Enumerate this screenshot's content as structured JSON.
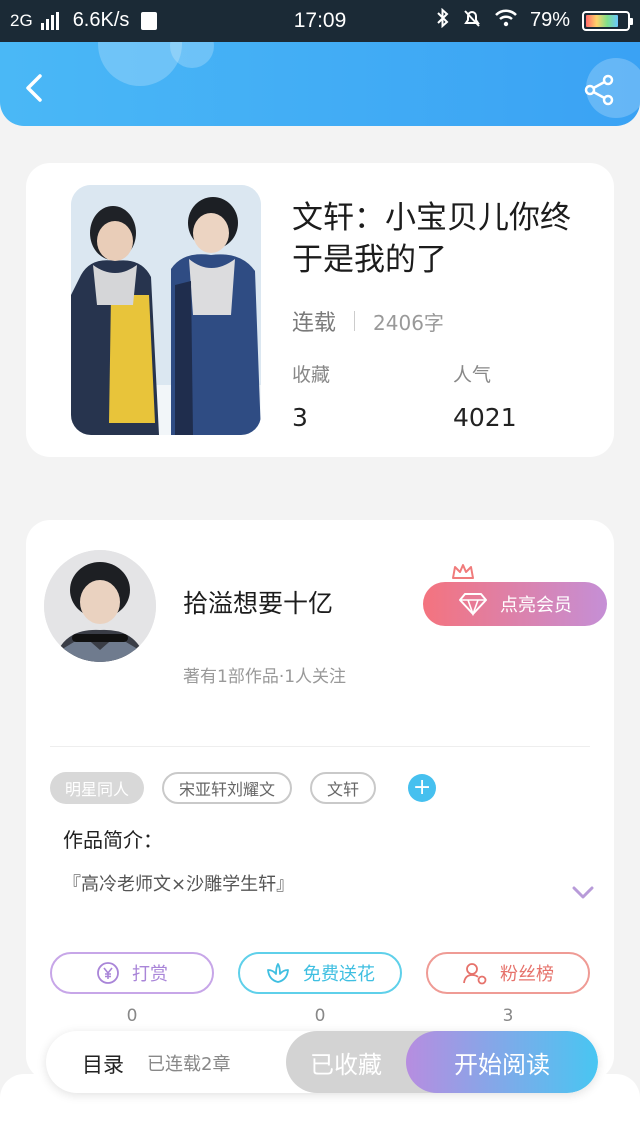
{
  "status_bar": {
    "network": "2G",
    "speed": "6.6K/s",
    "time": "17:09",
    "battery": "79%",
    "battery_level": 0.79
  },
  "header": {
    "back_icon": "chevron-left-icon",
    "share_icon": "share-icon",
    "gradient": [
      "#4ab8f6",
      "#3aa2f4"
    ]
  },
  "book": {
    "title": "文轩：小宝贝儿你终于是我的了",
    "status": "连载",
    "word_count": "2406字",
    "stats": [
      {
        "label": "收藏",
        "value": "3"
      },
      {
        "label": "人气",
        "value": "4021"
      }
    ]
  },
  "author": {
    "name": "拾溢想要十亿",
    "info": "著有1部作品·1人关注",
    "vip_button": "点亮会员"
  },
  "tags": [
    "明星同人",
    "宋亚轩刘耀文",
    "文轩"
  ],
  "intro": {
    "label": "作品简介：",
    "text": "『高冷老师文×沙雕学生轩』"
  },
  "actions": [
    {
      "label": "打赏",
      "count": "0",
      "icon": "yen-coin-icon",
      "color": "#a985d8"
    },
    {
      "label": "免费送花",
      "count": "0",
      "icon": "flower-icon",
      "color": "#3fbfe1"
    },
    {
      "label": "粉丝榜",
      "count": "3",
      "icon": "user-rank-icon",
      "color": "#e6726b"
    }
  ],
  "bottom_bar": {
    "toc": "目录",
    "chapters": "已连载2章",
    "collected": "已收藏",
    "read": "开始阅读"
  }
}
